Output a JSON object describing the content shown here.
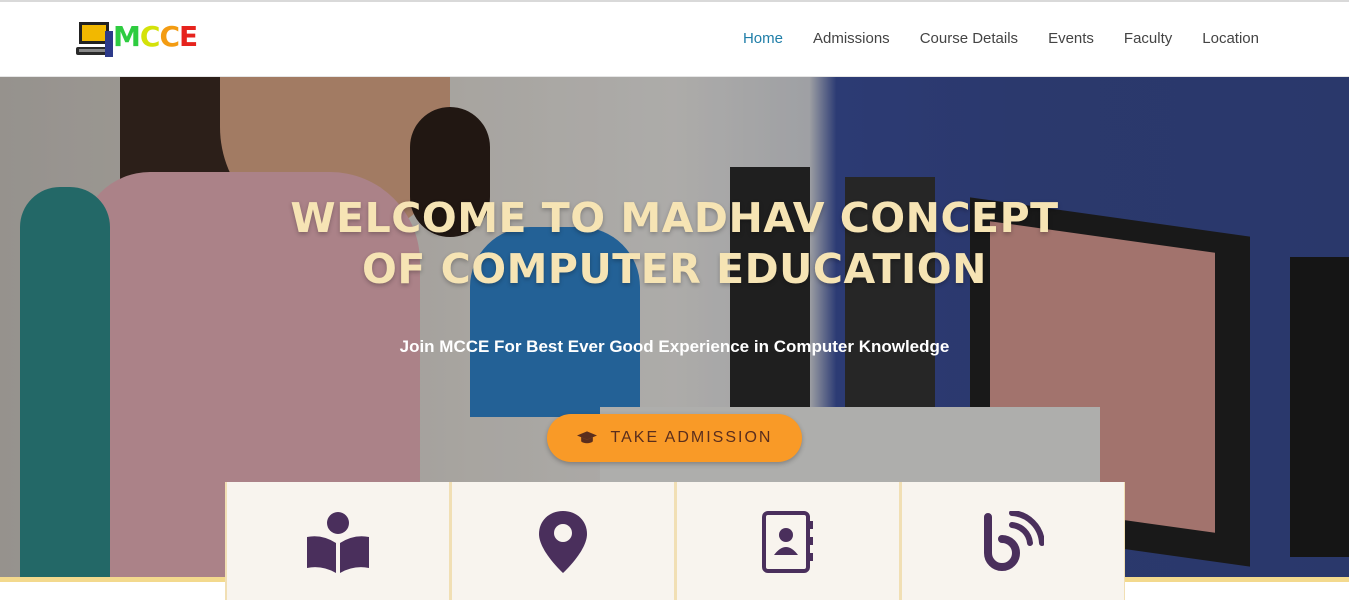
{
  "brand": {
    "logo_text": "MCCE",
    "letters": [
      "M",
      "C",
      "C",
      "E"
    ]
  },
  "nav": {
    "items": [
      {
        "label": "Home",
        "active": true
      },
      {
        "label": "Admissions",
        "active": false
      },
      {
        "label": "Course Details",
        "active": false
      },
      {
        "label": "Events",
        "active": false
      },
      {
        "label": "Faculty",
        "active": false
      },
      {
        "label": "Location",
        "active": false
      }
    ]
  },
  "hero": {
    "title_line1": "WELCOME TO MADHAV CONCEPT",
    "title_line2": "OF COMPUTER EDUCATION",
    "subtitle": "Join MCCE For Best Ever Good Experience in Computer Knowledge",
    "cta_label": "TAKE ADMISSION",
    "cta_icon": "graduation-cap-icon"
  },
  "feature_cards": [
    {
      "icon": "reader-book-icon"
    },
    {
      "icon": "map-pin-icon"
    },
    {
      "icon": "contact-book-icon"
    },
    {
      "icon": "blog-feed-icon"
    }
  ],
  "colors": {
    "nav_active": "#1f7ea8",
    "cta_background": "#f99a27",
    "title_color": "#f6e4b4",
    "icon_color": "#4a2f5c",
    "card_background": "#f8f4ee",
    "band_color": "#f3d98d"
  }
}
